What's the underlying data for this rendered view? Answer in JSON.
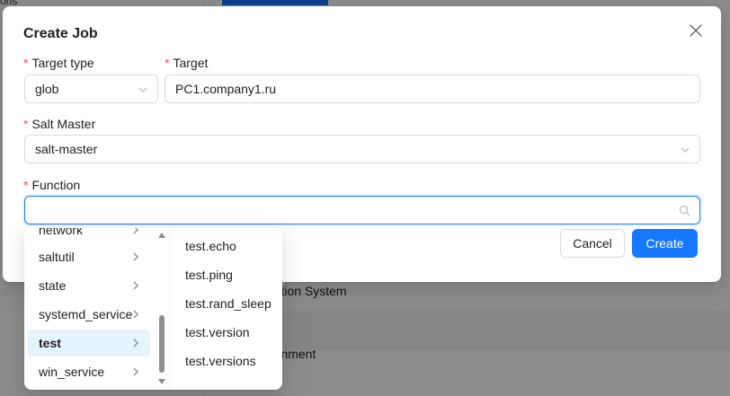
{
  "background": {
    "fragment_top": "ons",
    "row1_text": "ration System",
    "row2_text": "ronment"
  },
  "modal": {
    "title": "Create Job",
    "close_icon": "close-icon",
    "fields": {
      "target_type": {
        "label": "Target type",
        "value": "glob"
      },
      "target": {
        "label": "Target",
        "value": "PC1.company1.ru"
      },
      "salt_master": {
        "label": "Salt Master",
        "value": "salt-master"
      },
      "function": {
        "label": "Function",
        "value": "",
        "placeholder": ""
      }
    },
    "required_mark": "*",
    "buttons": {
      "cancel": "Cancel",
      "create": "Create"
    }
  },
  "cascader": {
    "modules": [
      {
        "label": "network",
        "active": false
      },
      {
        "label": "saltutil",
        "active": false
      },
      {
        "label": "state",
        "active": false
      },
      {
        "label": "systemd_service",
        "active": false
      },
      {
        "label": "test",
        "active": true
      },
      {
        "label": "win_service",
        "active": false
      }
    ],
    "functions": [
      "test.echo",
      "test.ping",
      "test.rand_sleep",
      "test.version",
      "test.versions"
    ]
  },
  "colors": {
    "primary": "#1677ff",
    "required": "#ff4d4f",
    "active_option_bg": "#e6f4ff",
    "overlay": "rgba(0,0,0,0.45)"
  }
}
